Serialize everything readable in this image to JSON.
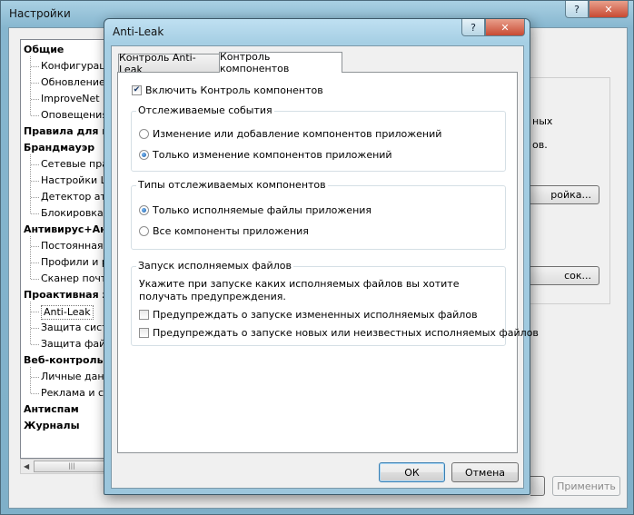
{
  "back_window": {
    "title": "Настройки",
    "help": "?",
    "close": "✕",
    "tree": [
      {
        "label": "Общие",
        "kind": "group"
      },
      {
        "label": "Конфигурац",
        "kind": "child"
      },
      {
        "label": "Обновление",
        "kind": "child"
      },
      {
        "label": "ImproveNet",
        "kind": "child"
      },
      {
        "label": "Оповещения",
        "kind": "child"
      },
      {
        "label": "Правила для пр",
        "kind": "group"
      },
      {
        "label": "Брандмауэр",
        "kind": "group"
      },
      {
        "label": "Сетевые пра",
        "kind": "child"
      },
      {
        "label": "Настройки L",
        "kind": "child"
      },
      {
        "label": "Детектор ата",
        "kind": "child"
      },
      {
        "label": "Блокировка",
        "kind": "child"
      },
      {
        "label": "Антивирус+Анти",
        "kind": "group"
      },
      {
        "label": "Постоянная",
        "kind": "child"
      },
      {
        "label": "Профили и р",
        "kind": "child"
      },
      {
        "label": "Сканер почт",
        "kind": "child"
      },
      {
        "label": "Проактивная за",
        "kind": "group"
      },
      {
        "label": "Anti-Leak",
        "kind": "child",
        "selected": true
      },
      {
        "label": "Защита сист",
        "kind": "child"
      },
      {
        "label": "Защита фай",
        "kind": "child"
      },
      {
        "label": "Веб-контроль",
        "kind": "group"
      },
      {
        "label": "Личные данн",
        "kind": "child"
      },
      {
        "label": "Реклама и са",
        "kind": "child"
      },
      {
        "label": "Антиспам",
        "kind": "group"
      },
      {
        "label": "Журналы",
        "kind": "group"
      }
    ],
    "right_text_1": "ных",
    "right_text_2": "ов.",
    "right_button_1": "ройка...",
    "right_button_2": "сок...",
    "apply_button": "Применить"
  },
  "dialog": {
    "title": "Anti-Leak",
    "help": "?",
    "close": "✕",
    "tabs": [
      {
        "label": "Контроль Anti-Leak",
        "active": false
      },
      {
        "label": "Контроль компонентов",
        "active": true
      }
    ],
    "enable_checkbox": {
      "label": "Включить Контроль компонентов",
      "checked": true
    },
    "group_events": {
      "legend": "Отслеживаемые события",
      "options": [
        {
          "label": "Изменение или добавление компонентов приложений",
          "selected": false
        },
        {
          "label": "Только изменение компонентов приложений",
          "selected": true
        }
      ]
    },
    "group_types": {
      "legend": "Типы отслеживаемых компонентов",
      "options": [
        {
          "label": "Только исполняемые файлы приложения",
          "selected": true
        },
        {
          "label": "Все компоненты приложения",
          "selected": false
        }
      ]
    },
    "group_exec": {
      "legend": "Запуск исполняемых файлов",
      "description": "Укажите при запуске каких исполняемых файлов вы хотите получать предупреждения.",
      "checkboxes": [
        {
          "label": "Предупреждать о запуске измененных исполняемых файлов",
          "checked": false
        },
        {
          "label": "Предупреждать о запуске новых или неизвестных исполняемых файлов",
          "checked": false
        }
      ]
    },
    "ok_button": "ОК",
    "cancel_button": "Отмена"
  }
}
